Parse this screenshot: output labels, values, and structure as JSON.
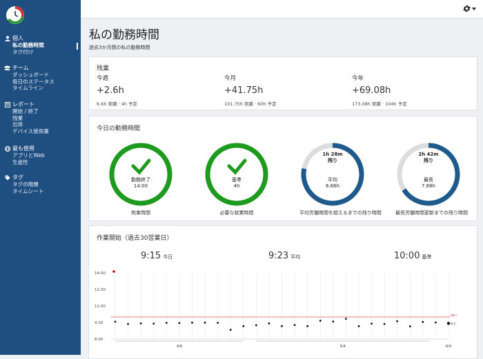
{
  "sidebar": {
    "sections": [
      {
        "label": "個人",
        "icon": "user-icon",
        "items": [
          {
            "label": "私の勤務時間",
            "active": true
          },
          {
            "label": "タグ付け"
          }
        ]
      },
      {
        "label": "チーム",
        "icon": "team-icon",
        "items": [
          {
            "label": "ダッシュボード"
          },
          {
            "label": "毎日のステータス"
          },
          {
            "label": "タイムライン"
          }
        ]
      },
      {
        "label": "レポート",
        "icon": "report-icon",
        "items": [
          {
            "label": "開始 / 終了"
          },
          {
            "label": "残業"
          },
          {
            "label": "出席"
          },
          {
            "label": "デバイス使用量"
          }
        ]
      },
      {
        "label": "最も使用",
        "icon": "globe-icon",
        "items": [
          {
            "label": "アプリとWeb"
          },
          {
            "label": "生産性"
          }
        ]
      },
      {
        "label": "タグ",
        "icon": "tag-icon",
        "items": [
          {
            "label": "タグの階層"
          },
          {
            "label": "タイムシート"
          }
        ]
      }
    ]
  },
  "header": {
    "title": "私の勤務時間",
    "subtitle": "過去3か月間の私の勤務時間"
  },
  "overtime": {
    "title": "残業",
    "cols": [
      {
        "label": "今週",
        "value": "+2.6h",
        "sub": "6.6h 実績 · 4h 予定"
      },
      {
        "label": "今月",
        "value": "+41.75h",
        "sub": "101.75h 実績 · 60h 予定"
      },
      {
        "label": "今年",
        "value": "+69.08h",
        "sub": "173.08h 実績 · 104h 予定"
      }
    ]
  },
  "today": {
    "title": "今日の勤務時間",
    "gauges": [
      {
        "type": "check",
        "label": "勤務終了",
        "value": "14:00",
        "footer": "拘束時間",
        "color": "#1e9a1e",
        "progress": 1
      },
      {
        "type": "check",
        "label": "基準",
        "value": "4h",
        "footer": "必要な就業時間",
        "color": "#1e9a1e",
        "progress": 1
      },
      {
        "type": "remain",
        "top": "1h 28m",
        "top2": "残り",
        "label": "平均",
        "value": "6.66h",
        "footer": "平均労働時間を超えるまでの残り時間",
        "color": "#1f5a8c",
        "progress": 0.78
      },
      {
        "type": "remain",
        "top": "2h 42m",
        "top2": "残り",
        "label": "最長",
        "value": "7.88h",
        "footer": "最長労働時間更新までの残り時間",
        "color": "#1f5a8c",
        "progress": 0.66
      }
    ]
  },
  "work_start": {
    "title": "作業開始（過去30営業日）",
    "stats": [
      {
        "value": "9:15",
        "label": "今日"
      },
      {
        "value": "9:23",
        "label": "平均"
      },
      {
        "value": "10:00",
        "label": "基準"
      }
    ]
  },
  "chart_data": {
    "type": "scatter",
    "title": "",
    "xlabel": "",
    "ylabel": "",
    "y_ticks": [
      "14:00",
      "12:30",
      "11:00",
      "9:30",
      "8:00"
    ],
    "ylim": [
      "8:00",
      "14:00"
    ],
    "reference_line": {
      "value": "10:00",
      "label": "ﾃ繝ｼﾀ",
      "color": "#e05050"
    },
    "x_group_labels": [
      "4/4",
      "5/4",
      "6/4"
    ],
    "points": [
      "9:34",
      "9:22",
      "9:25",
      "9:24",
      "9:28",
      "9:27",
      "9:29",
      "9:29",
      "9:28",
      "8:50",
      "9:10",
      "9:15",
      "9:25",
      "9:10",
      "9:16",
      "9:10",
      "9:40",
      "9:35",
      "9:50",
      "9:10",
      "9:24",
      "9:22",
      "9:37",
      "9:09",
      "9:33",
      "9:30",
      "9:25"
    ],
    "outlier": "14:00",
    "last_label": "9:2"
  },
  "colors": {
    "sidebar": "#1f4e80",
    "accent": "#1e9a1e",
    "gauge_blue": "#1f5a8c",
    "ref_line": "#e05050"
  }
}
